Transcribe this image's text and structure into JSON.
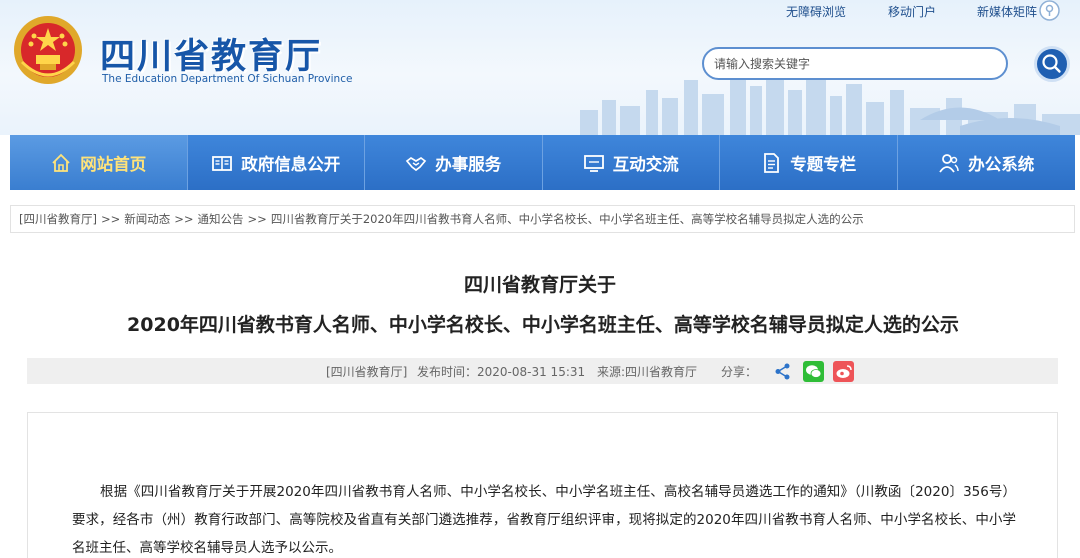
{
  "header": {
    "top_links": [
      "无障碍浏览",
      "移动门户",
      "新媒体矩阵"
    ],
    "site_title": "四川省教育厅",
    "site_subtitle": "The Education Department Of Sichuan Province",
    "search_placeholder": "请输入搜索关键字"
  },
  "nav": {
    "items": [
      {
        "label": "网站首页",
        "icon": "home-icon"
      },
      {
        "label": "政府信息公开",
        "icon": "book-icon"
      },
      {
        "label": "办事服务",
        "icon": "handshake-icon"
      },
      {
        "label": "互动交流",
        "icon": "monitor-icon"
      },
      {
        "label": "专题专栏",
        "icon": "document-icon"
      },
      {
        "label": "办公系统",
        "icon": "users-icon"
      }
    ],
    "active_index": 0
  },
  "breadcrumb": {
    "items": [
      "[四川省教育厅]",
      "新闻动态",
      "通知公告",
      "四川省教育厅关于2020年四川省教书育人名师、中小学名校长、中小学名班主任、高等学校名辅导员拟定人选的公示"
    ],
    "separator": ">>"
  },
  "article": {
    "title_line1": "四川省教育厅关于",
    "title_line2": "2020年四川省教书育人名师、中小学名校长、中小学名班主任、高等学校名辅导员拟定人选的公示",
    "meta": {
      "publisher": "[四川省教育厅]",
      "publish_time": "发布时间：2020-08-31 15:31",
      "source": "来源:四川省教育厅",
      "share_label": "分享："
    },
    "body": "根据《四川省教育厅关于开展2020年四川省教书育人名师、中小学名校长、中小学名班主任、高校名辅导员遴选工作的通知》（川教函〔2020〕356号）要求，经各市（州）教育行政部门、高等院校及省直有关部门遴选推荐，省教育厅组织评审，现将拟定的2020年四川省教书育人名师、中小学名校长、中小学名班主任、高等学校名辅导员人选予以公示。"
  },
  "colors": {
    "nav_bg": "#2c6fc6",
    "nav_active_text": "#ffe37a",
    "title_blue": "#1756a8",
    "wechat_green": "#2fbd37",
    "weibo_red": "#ee5458"
  }
}
